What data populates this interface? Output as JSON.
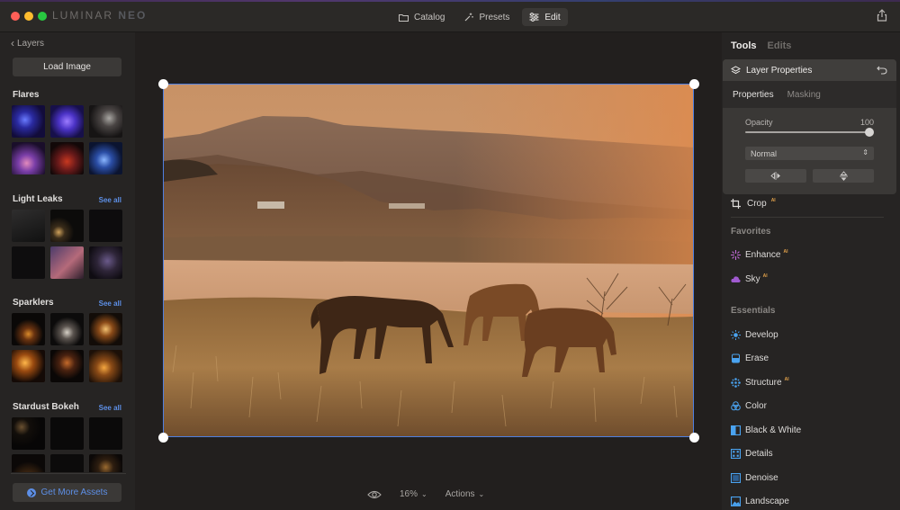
{
  "app": {
    "logo_text": "LUMINAR",
    "logo_suffix": "NEO"
  },
  "topnav": [
    {
      "label": "Catalog",
      "active": false
    },
    {
      "label": "Presets",
      "active": false
    },
    {
      "label": "Edit",
      "active": true
    }
  ],
  "left_panel": {
    "back_label": "Layers",
    "load_button": "Load Image",
    "sections": [
      {
        "title": "Flares",
        "see_all": ""
      },
      {
        "title": "Light Leaks",
        "see_all": "See all"
      },
      {
        "title": "Sparklers",
        "see_all": "See all"
      },
      {
        "title": "Stardust Bokeh",
        "see_all": "See all"
      }
    ],
    "more_button": "Get More Assets"
  },
  "canvas": {
    "zoom": "16%",
    "actions_label": "Actions"
  },
  "right_panel": {
    "tabs": [
      {
        "label": "Tools",
        "active": true
      },
      {
        "label": "Edits",
        "active": false
      }
    ],
    "layer_properties": {
      "title": "Layer Properties",
      "subtabs": [
        {
          "label": "Properties",
          "active": true
        },
        {
          "label": "Masking",
          "active": false
        }
      ],
      "opacity_label": "Opacity",
      "opacity_value": "100",
      "opacity_fraction": 1.0,
      "blend_mode": "Normal"
    },
    "crop": {
      "label": "Crop",
      "ai": "AI"
    },
    "favorites": {
      "label": "Favorites",
      "items": [
        {
          "label": "Enhance",
          "ai": "AI",
          "icon": "enhance-icon"
        },
        {
          "label": "Sky",
          "ai": "AI",
          "icon": "cloud-icon"
        }
      ]
    },
    "essentials": {
      "label": "Essentials",
      "items": [
        {
          "label": "Develop",
          "ai": "",
          "icon": "sun-icon"
        },
        {
          "label": "Erase",
          "ai": "",
          "icon": "eraser-icon"
        },
        {
          "label": "Structure",
          "ai": "AI",
          "icon": "structure-icon"
        },
        {
          "label": "Color",
          "ai": "",
          "icon": "color-icon"
        },
        {
          "label": "Black & White",
          "ai": "",
          "icon": "bw-icon"
        },
        {
          "label": "Details",
          "ai": "",
          "icon": "details-icon"
        },
        {
          "label": "Denoise",
          "ai": "",
          "icon": "denoise-icon"
        },
        {
          "label": "Landscape",
          "ai": "",
          "icon": "landscape-icon"
        }
      ]
    }
  },
  "colors": {
    "accent": "#5d8fe6",
    "ai_badge": "#e0a04a",
    "selection": "#4f7fe0"
  }
}
